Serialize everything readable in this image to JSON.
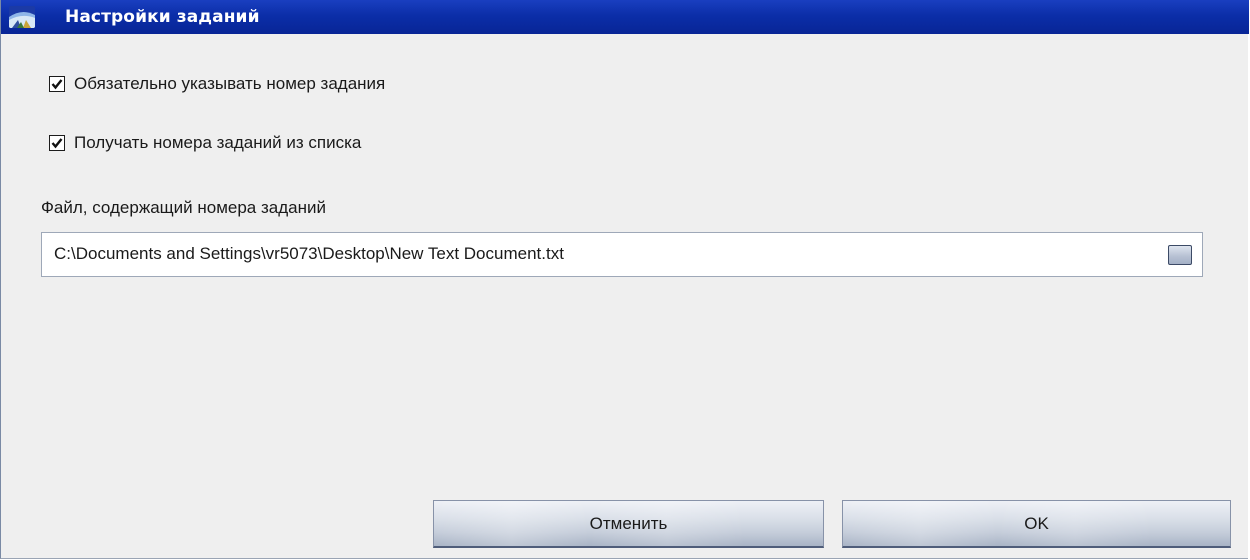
{
  "window": {
    "title": "Настройки заданий"
  },
  "options": {
    "require_job_number": {
      "label": "Обязательно указывать номер задания",
      "checked": true
    },
    "get_job_numbers_from_list": {
      "label": "Получать номера заданий из списка",
      "checked": true
    }
  },
  "file": {
    "label": "Файл, содержащий номера заданий",
    "value": "C:\\Documents and Settings\\vr5073\\Desktop\\New Text Document.txt"
  },
  "buttons": {
    "cancel_label": "Отменить",
    "ok_label": "OK"
  },
  "colors": {
    "titlebar": "#0b2ea8",
    "background": "#efefef"
  },
  "icons": {
    "app": "app-logo-icon",
    "check": "checkmark-icon",
    "browse": "browse-icon"
  }
}
